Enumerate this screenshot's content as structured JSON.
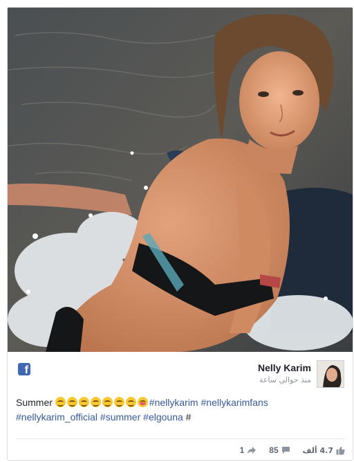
{
  "post": {
    "author_name": "Nelly Karim",
    "timestamp": "منذ حوالي ساعة",
    "caption_text": "Summer",
    "caption_emojis": [
      "grinning-face",
      "grinning-face",
      "grinning-face",
      "grinning-face",
      "grinning-face",
      "grinning-face",
      "grinning-face",
      "winking-tongue-face"
    ],
    "hashtags_line1": [
      "#nellykarim",
      "#nellykarimfans"
    ],
    "hashtags_line2": [
      "#nellykarim_official",
      "#summer",
      "#elgouna",
      "#"
    ]
  },
  "stats": {
    "shares": "1",
    "comments": "85",
    "likes": "4.7 ألف"
  },
  "icons": {
    "platform": "facebook-logo-icon",
    "share": "share-arrow-icon",
    "comment": "comment-bubble-icon",
    "like": "thumbs-up-icon"
  },
  "colors": {
    "facebook_blue": "#4267b2",
    "hashtag": "#365899",
    "meta_text": "#90949c",
    "stat_text": "#606770",
    "border": "#dddfe2"
  }
}
